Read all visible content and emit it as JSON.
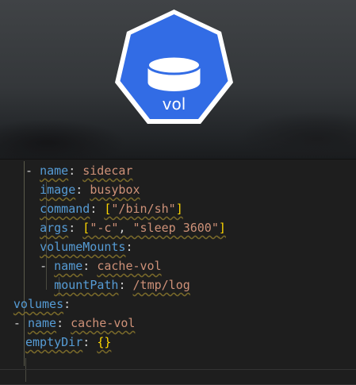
{
  "logo": {
    "icon": "kubernetes-volume-icon",
    "label": "vol",
    "color": "#326ce5"
  },
  "editor": {
    "language": "yaml",
    "lines": [
      {
        "indent": 2,
        "dash": true,
        "key": "name",
        "value": "sidecar"
      },
      {
        "indent": 4,
        "dash": false,
        "key": "image",
        "value": "busybox"
      },
      {
        "indent": 4,
        "dash": false,
        "key": "command",
        "value": "[\"/bin/sh\"]"
      },
      {
        "indent": 4,
        "dash": false,
        "key": "args",
        "value": "[\"-c\", \"sleep 3600\"]"
      },
      {
        "indent": 4,
        "dash": false,
        "key": "volumeMounts",
        "value": ""
      },
      {
        "indent": 4,
        "dash": true,
        "key": "name",
        "value": "cache-vol"
      },
      {
        "indent": 6,
        "dash": false,
        "key": "mountPath",
        "value": "/tmp/log"
      },
      {
        "indent": 0,
        "dash": false,
        "key": "volumes",
        "value": ""
      },
      {
        "indent": 0,
        "dash": true,
        "key": "name",
        "value": "cache-vol"
      },
      {
        "indent": 2,
        "dash": false,
        "key": "emptyDir",
        "value": "{}"
      }
    ]
  }
}
